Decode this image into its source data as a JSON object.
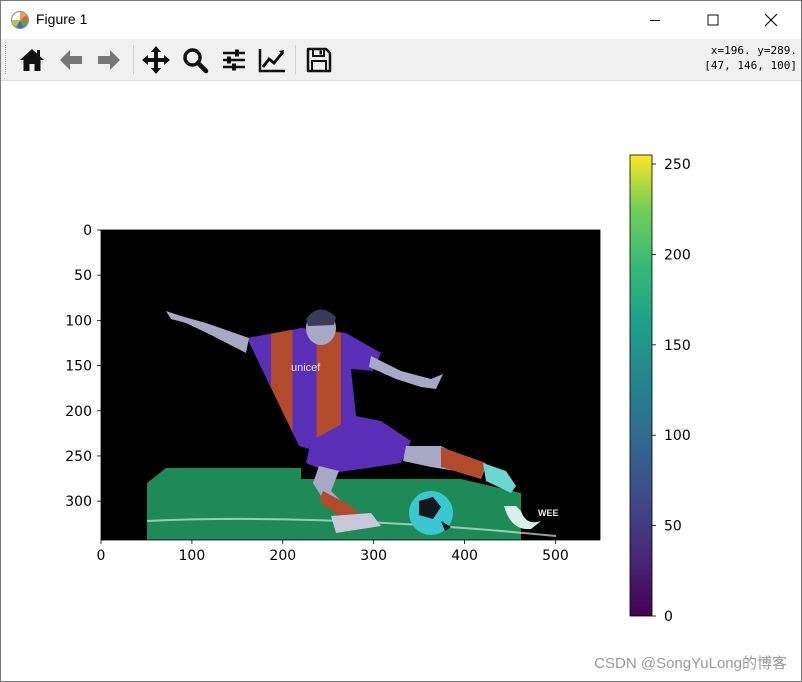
{
  "window": {
    "title": "Figure 1"
  },
  "toolbar": {
    "buttons": [
      {
        "name": "home-button",
        "icon": "home-icon",
        "tooltip": "Reset original view"
      },
      {
        "name": "back-button",
        "icon": "arrow-left-icon",
        "tooltip": "Back to previous view"
      },
      {
        "name": "forward-button",
        "icon": "arrow-right-icon",
        "tooltip": "Forward to next view"
      },
      {
        "name": "pan-button",
        "icon": "move-icon",
        "tooltip": "Pan axes"
      },
      {
        "name": "zoom-button",
        "icon": "magnifier-icon",
        "tooltip": "Zoom to rectangle"
      },
      {
        "name": "subplots-button",
        "icon": "sliders-icon",
        "tooltip": "Configure subplots"
      },
      {
        "name": "edit-axis-button",
        "icon": "line-chart-icon",
        "tooltip": "Edit axis"
      },
      {
        "name": "save-button",
        "icon": "floppy-disk-icon",
        "tooltip": "Save the figure"
      }
    ],
    "coords_line1": "x=196. y=289.",
    "coords_line2": "[47, 146, 100]"
  },
  "image_axes": {
    "x_ticks": [
      "0",
      "100",
      "200",
      "300",
      "400",
      "500"
    ],
    "y_ticks": [
      "0",
      "50",
      "100",
      "150",
      "200",
      "250",
      "300"
    ],
    "xlim": [
      0,
      549
    ],
    "ylim": [
      343,
      0
    ],
    "image_labels": {
      "jersey_sponsor": "unicef",
      "logo_text": "WEE"
    }
  },
  "colorbar": {
    "colormap": "viridis",
    "range": [
      0,
      255
    ],
    "ticks": [
      "0",
      "50",
      "100",
      "150",
      "200",
      "250"
    ]
  },
  "watermark": "CSDN @SongYuLong的博客"
}
